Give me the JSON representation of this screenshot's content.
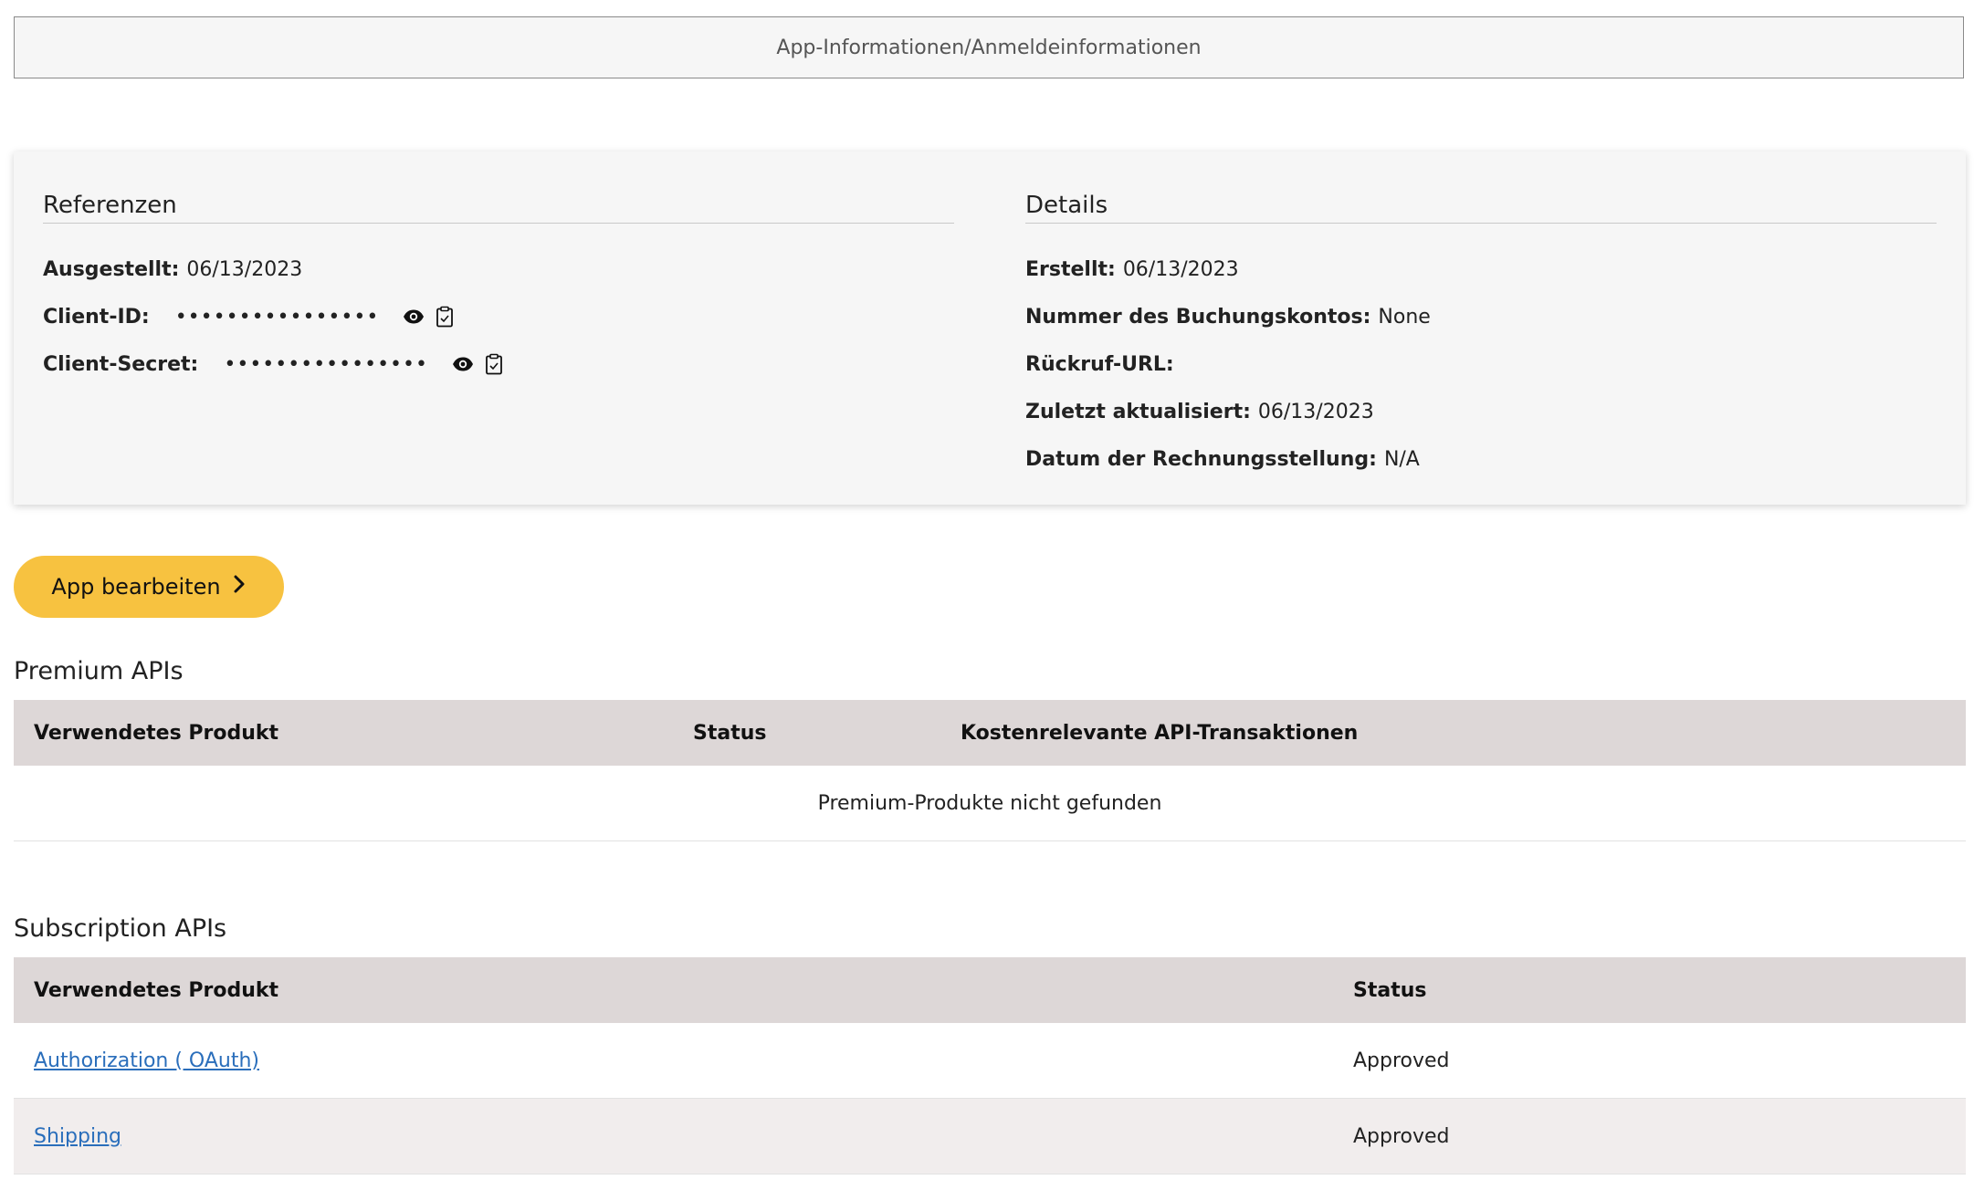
{
  "tabs": {
    "active_label": "App-Informationen/Anmeldeinformationen"
  },
  "credentials": {
    "title": "Referenzen",
    "issued_label": "Ausgestellt:",
    "issued_value": "06/13/2023",
    "client_id_label": "Client-ID:",
    "client_id_masked": "••••••••••••••••",
    "client_secret_label": "Client-Secret:",
    "client_secret_masked": "••••••••••••••••",
    "icons": [
      "eye-icon",
      "clipboard-icon"
    ]
  },
  "details": {
    "title": "Details",
    "created_label": "Erstellt:",
    "created_value": "06/13/2023",
    "account_label": "Nummer des Buchungskontos:",
    "account_value": "None",
    "callback_label": "Rückruf-URL:",
    "callback_value": "",
    "updated_label": "Zuletzt aktualisiert:",
    "updated_value": "06/13/2023",
    "billing_label": "Datum der Rechnungsstellung:",
    "billing_value": "N/A"
  },
  "edit_button": {
    "label": "App bearbeiten"
  },
  "premium": {
    "title": "Premium APIs",
    "columns": [
      "Verwendetes Produkt",
      "Status",
      "Kostenrelevante API-Transaktionen"
    ],
    "empty_message": "Premium-Produkte nicht gefunden"
  },
  "subscription": {
    "title": "Subscription APIs",
    "columns": [
      "Verwendetes Produkt",
      "Status"
    ],
    "rows": [
      {
        "product": "Authorization ( OAuth)",
        "status": "Approved"
      },
      {
        "product": "Shipping",
        "status": "Approved"
      }
    ]
  },
  "colors": {
    "accent_button": "#f7c240",
    "link": "#2a6ebb",
    "table_header": "#ddd7d7"
  }
}
